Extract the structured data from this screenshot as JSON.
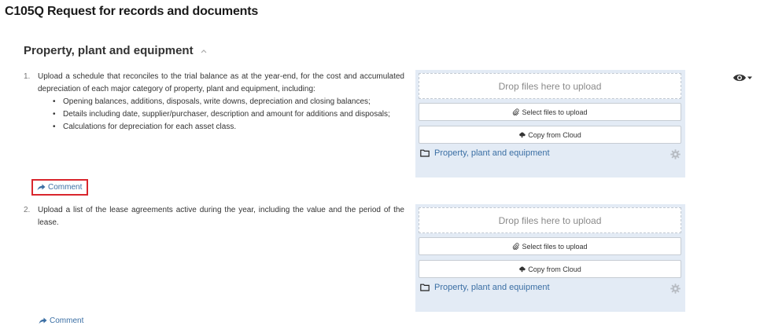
{
  "page": {
    "title": "C105Q Request for records and documents"
  },
  "section": {
    "title": "Property, plant and equipment",
    "collapse_icon": "chevron-up-icon"
  },
  "view_menu": {
    "icon": "eye-icon",
    "caret_icon": "caret-down-icon"
  },
  "items": [
    {
      "number": "1.",
      "text": "Upload a schedule that reconciles to the trial balance as at the year-end, for the cost and accumulated depreciation of each major category of property, plant and equipment, including:",
      "bullets": [
        "Opening balances, additions, disposals, write downs, depreciation and closing balances;",
        "Details including date, supplier/purchaser, description and amount for additions and disposals;",
        "Calculations for depreciation for each asset class."
      ],
      "upload": {
        "drop_text": "Drop files here to upload",
        "select_label": "Select files to upload",
        "cloud_label": "Copy from Cloud",
        "folder_label": "Property, plant and equipment"
      },
      "comment_label": "Comment"
    },
    {
      "number": "2.",
      "text": "Upload a list of the lease agreements active during the year, including the value and the period of the lease.",
      "bullets": [],
      "upload": {
        "drop_text": "Drop files here to upload",
        "select_label": "Select files to upload",
        "cloud_label": "Copy from Cloud",
        "folder_label": "Property, plant and equipment"
      },
      "comment_label": "Comment"
    }
  ],
  "colors": {
    "link": "#3b6fa4",
    "panel_bg": "#e3ebf5",
    "highlight": "#d9262d"
  }
}
